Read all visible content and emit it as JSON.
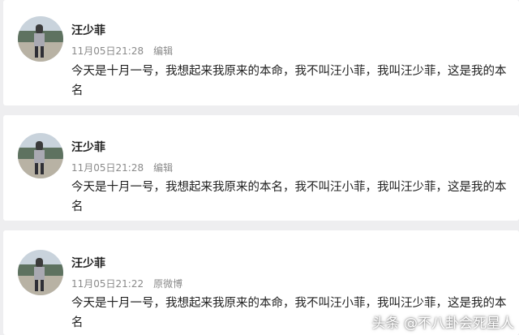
{
  "posts": [
    {
      "author": "汪少菲",
      "time": "11月05日21:28",
      "action": "编辑",
      "text": "今天是十月一号，我想起来我原来的本命，我不叫汪小菲，我叫汪少菲，这是我的本名"
    },
    {
      "author": "汪少菲",
      "time": "11月05日21:28",
      "action": "编辑",
      "text": "今天是十月一号，我想起来我原来的本名，我不叫汪小菲，我叫汪少菲，这是我的本名"
    },
    {
      "author": "汪少菲",
      "time": "11月05日21:22",
      "action": "原微博",
      "text": "今天是十月一号，我想起来我原来的本命，我不叫汪小菲，我叫汪少菲，这是我的本名"
    }
  ],
  "watermark": "头条 @不八卦会死星人"
}
